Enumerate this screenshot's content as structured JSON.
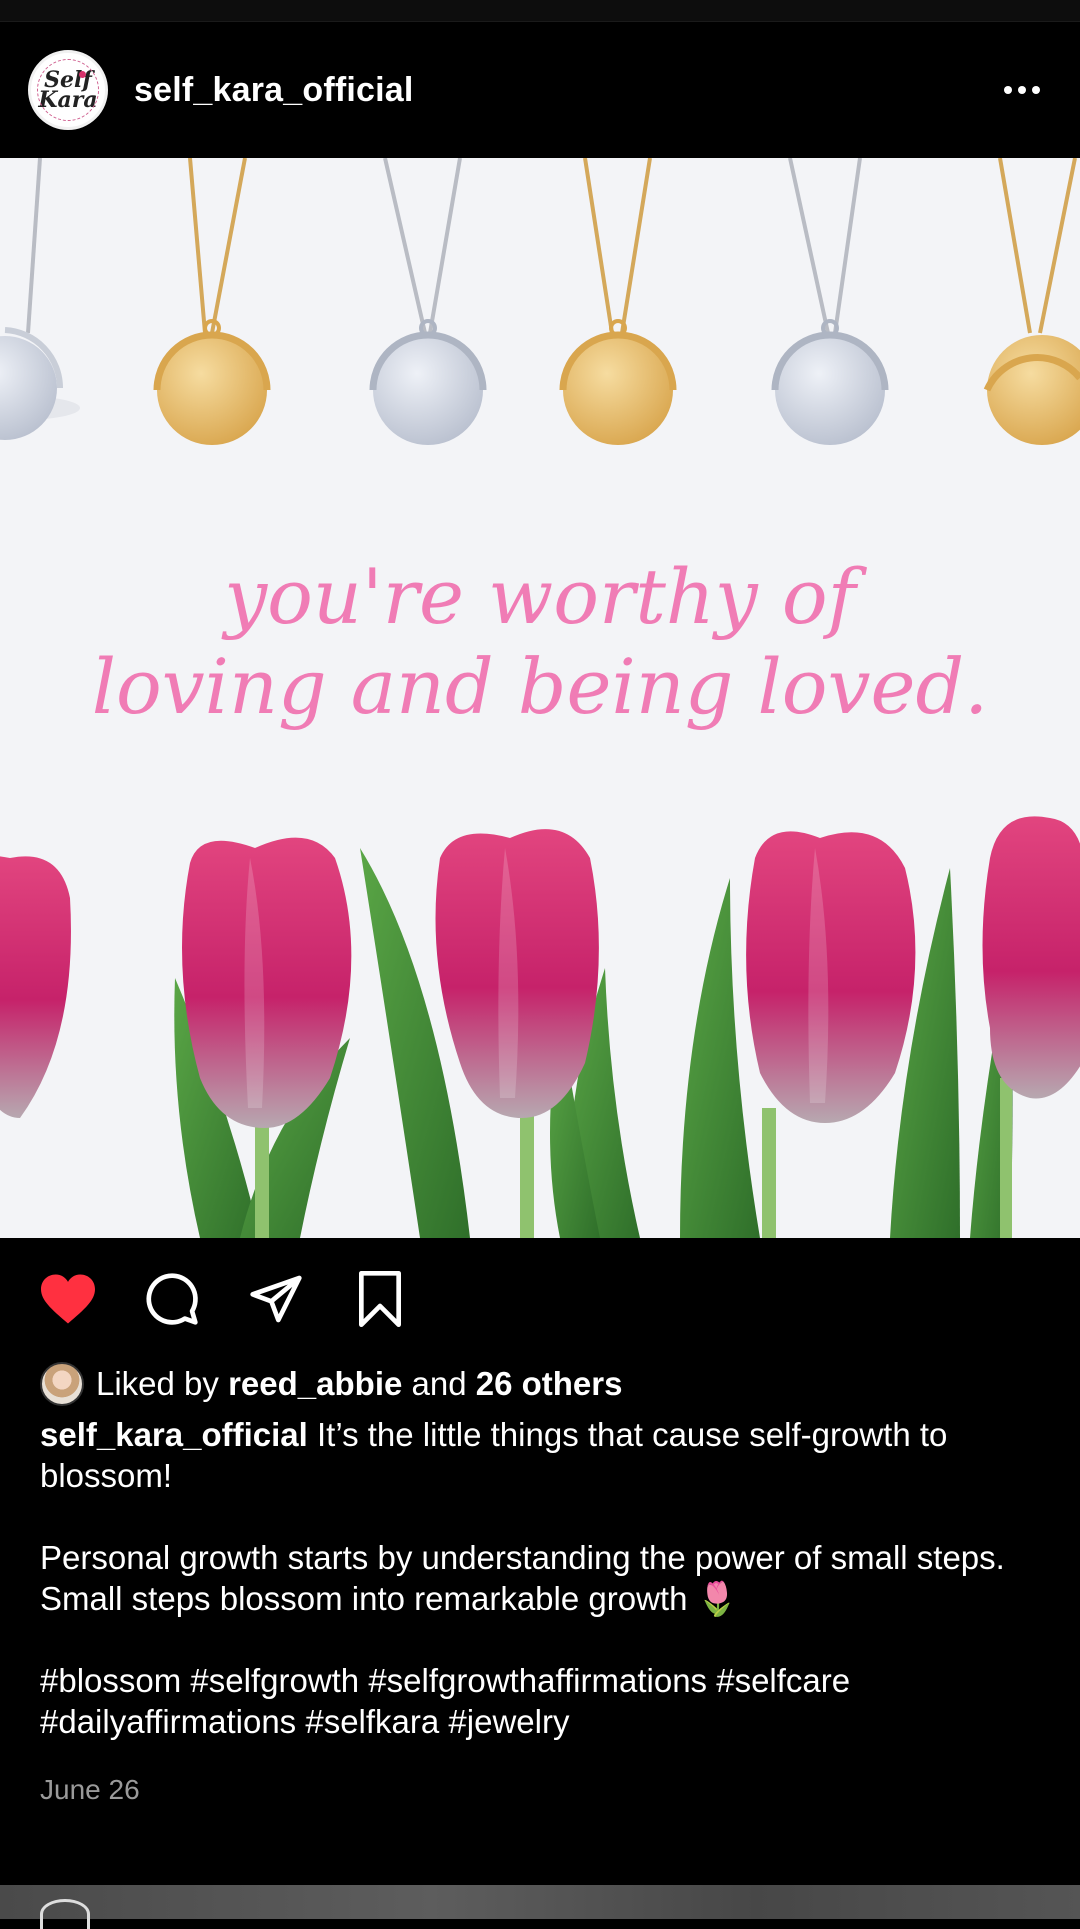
{
  "post": {
    "username": "self_kara_official",
    "avatar_text": "Self Kara",
    "image_text_line1": "you're worthy of",
    "image_text_line2": "loving and being loved.",
    "liked_prefix": "Liked by",
    "liked_user": "reed_abbie",
    "liked_and": "and",
    "liked_others": "26 others",
    "caption_user": "self_kara_official",
    "caption_line1": "It’s the little things that cause self-growth to blossom!",
    "caption_para2": "Personal growth starts by understanding the power of small steps. Small steps blossom into remarkable growth 🌷",
    "caption_hashtags": "#blossom #selfgrowth #selfgrowthaffirmations #selfcare #dailyaffirmations #selfkara #jewelry",
    "date": "June 26"
  },
  "icons": {
    "like": "heart-icon",
    "comment": "comment-icon",
    "share": "share-icon",
    "save": "bookmark-icon",
    "more": "more-icon"
  },
  "colors": {
    "liked_heart": "#ff3040",
    "script_text": "#f07cb5",
    "tulip": "#d2306f",
    "leaf": "#4e9a3a",
    "gold": "#e8bf6a",
    "silver": "#cfd5e2"
  }
}
